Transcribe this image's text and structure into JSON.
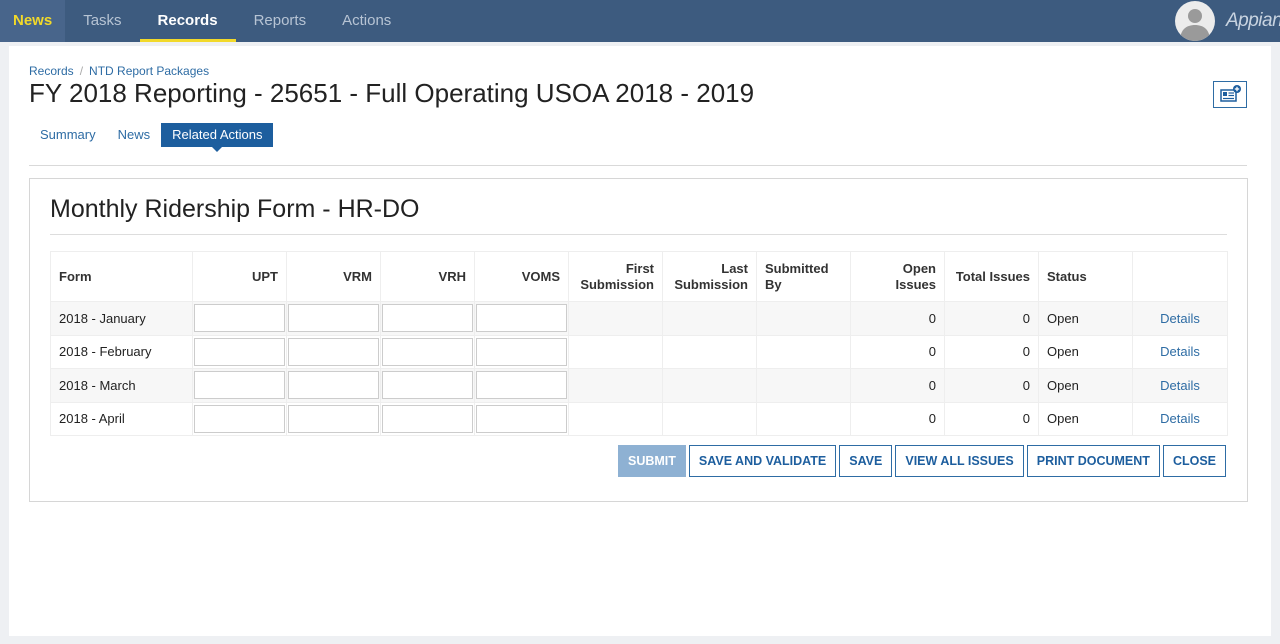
{
  "nav": {
    "items": [
      {
        "label": "News"
      },
      {
        "label": "Tasks"
      },
      {
        "label": "Records"
      },
      {
        "label": "Reports"
      },
      {
        "label": "Actions"
      }
    ],
    "logo": "Appian"
  },
  "breadcrumb": {
    "items": [
      {
        "label": "Records"
      },
      {
        "label": "NTD Report Packages"
      }
    ],
    "separator": "/"
  },
  "page_title": "FY 2018 Reporting - 25651 - Full Operating USOA 2018 - 2019",
  "tabs": [
    {
      "label": "Summary",
      "active": false
    },
    {
      "label": "News",
      "active": false
    },
    {
      "label": "Related Actions",
      "active": true
    }
  ],
  "form": {
    "title": "Monthly Ridership Form - HR-DO",
    "columns": [
      "Form",
      "UPT",
      "VRM",
      "VRH",
      "VOMS",
      "First Submission",
      "Last Submission",
      "Submitted By",
      "Open Issues",
      "Total Issues",
      "Status",
      ""
    ],
    "rows": [
      {
        "form": "2018 - January",
        "upt": "",
        "vrm": "",
        "vrh": "",
        "voms": "",
        "first_submission": "",
        "last_submission": "",
        "submitted_by": "",
        "open_issues": "0",
        "total_issues": "0",
        "status": "Open",
        "link": "Details"
      },
      {
        "form": "2018 - February",
        "upt": "",
        "vrm": "",
        "vrh": "",
        "voms": "",
        "first_submission": "",
        "last_submission": "",
        "submitted_by": "",
        "open_issues": "0",
        "total_issues": "0",
        "status": "Open",
        "link": "Details"
      },
      {
        "form": "2018 - March",
        "upt": "",
        "vrm": "",
        "vrh": "",
        "voms": "",
        "first_submission": "",
        "last_submission": "",
        "submitted_by": "",
        "open_issues": "0",
        "total_issues": "0",
        "status": "Open",
        "link": "Details"
      },
      {
        "form": "2018 - April",
        "upt": "",
        "vrm": "",
        "vrh": "",
        "voms": "",
        "first_submission": "",
        "last_submission": "",
        "submitted_by": "",
        "open_issues": "0",
        "total_issues": "0",
        "status": "Open",
        "link": "Details"
      }
    ],
    "buttons": {
      "submit": "SUBMIT",
      "save_and_validate": "SAVE AND VALIDATE",
      "save": "SAVE",
      "view_all_issues": "VIEW ALL ISSUES",
      "print_document": "PRINT DOCUMENT",
      "close": "CLOSE"
    }
  },
  "colors": {
    "topbar": "#3d5b7f",
    "accent_yellow": "#f2d92a",
    "link_blue": "#2e6ca4",
    "active_tab": "#1d5e9e",
    "submit_disabled": "#8eb1d3"
  },
  "icons": {
    "avatar": "user-avatar-icon",
    "document": "related-documents-icon"
  }
}
